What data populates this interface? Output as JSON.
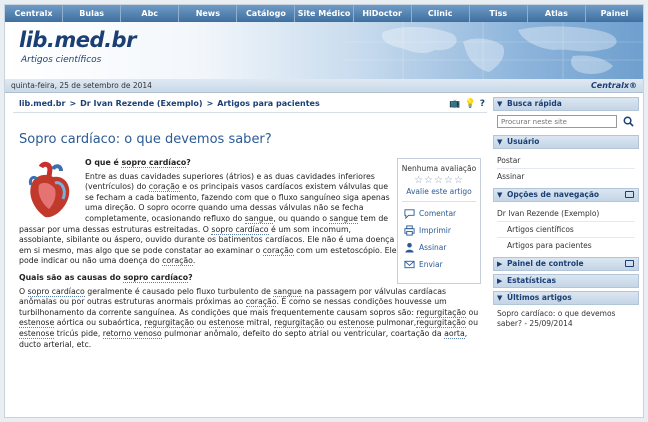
{
  "nav": [
    "Centralx",
    "Bulas",
    "Abc",
    "News",
    "Catálogo",
    "Site Médico",
    "HiDoctor",
    "Clinic",
    "Tiss",
    "Atlas",
    "Painel"
  ],
  "header": {
    "title": "lib.med.br",
    "subtitle": "Artigos científicos",
    "date": "quinta-feira, 25 de setembro de 2014",
    "brand": "Centralx®"
  },
  "breadcrumb": [
    "lib.med.br",
    "Dr Ivan Rezende (Exemplo)",
    "Artigos para pacientes"
  ],
  "breadcrumb_sep": ">",
  "tools": {
    "tv": "📺",
    "tip": "💡",
    "help": "?"
  },
  "article": {
    "title": "Sopro cardíaco: o que devemos saber?",
    "h1_prefix": "O que é ",
    "h1_link": "sopro cardíaco",
    "h1_suffix": "?",
    "p1_a": "Entre as duas cavidades superiores (átrios) e as duas cavidades inferiores (ventrículos) do ",
    "p1_link1": "coração",
    "p1_b": " e os principais vasos cardíacos existem válvulas que se fecham a cada batimento, fazendo com que o fluxo sanguíneo siga apenas uma direção. O sopro ocorre quando uma dessas válvulas não se fecha completamente, ocasionando refluxo do ",
    "p1_link2": "sangue",
    "p1_c": ", ou quando o ",
    "p1_link3": "sangue",
    "p1_d": " tem de passar por uma dessas estruturas estreitadas. O ",
    "p1_link4": "sopro cardíaco",
    "p1_e": " é um som incomum, assobiante, sibilante ou áspero, ouvido durante os batimentos cardíacos. Ele não é uma doença em si mesmo, mas algo que se pode constatar ao examinar o ",
    "p1_link5": "coração",
    "p1_f": " com um estetoscópio. Ele pode indicar ou não uma doença do ",
    "p1_link6": "coração",
    "p1_g": ".",
    "h2_prefix": "Quais são as causas do ",
    "h2_link": "sopro cardíaco",
    "h2_suffix": "?",
    "p2_a": "O ",
    "p2_link1": "sopro cardíaco",
    "p2_b": " geralmente é causado pelo fluxo turbulento de ",
    "p2_link2": "sangue",
    "p2_c": " na passagem por válvulas cardíacas anômalas ou por outras estruturas anormais próximas ao ",
    "p2_link3": "coração",
    "p2_d": ". É como se nessas condições houvesse um turbilhonamento da corrente sanguínea. As condições que mais frequentemente causam sopros são: ",
    "p2_link4": "regurgitação",
    "p2_e": " ou ",
    "p2_link5": "estenose",
    "p2_f": " aórtica ou subaórtica, ",
    "p2_link6": "regurgitação",
    "p2_g": " ou ",
    "p2_link7": "estenose",
    "p2_h": " mitral, ",
    "p2_link8": "regurgitação",
    "p2_i": " ou ",
    "p2_link9": "estenose",
    "p2_j": " pulmonar,",
    "p2_link10": "regurgitação",
    "p2_k": " ou ",
    "p2_link11": "estenose",
    "p2_l": " tricús pide, ",
    "p2_link12": "retorno venoso",
    "p2_m": " pulmonar anômalo, defeito do septo atrial ou ventricular, coartação da ",
    "p2_link13": "aorta",
    "p2_n": ", ducto arterial, etc."
  },
  "sidebox": {
    "rating_text": "Nenhuma avaliação",
    "stars": "☆☆☆☆☆",
    "rating_value": 0,
    "evaluate": "Avalie este artigo",
    "actions": [
      "Comentar",
      "Imprimir",
      "Assinar",
      "Enviar"
    ]
  },
  "sidebar": {
    "quick_search": {
      "title": "Busca rápida",
      "placeholder": "Procurar neste site"
    },
    "user": {
      "title": "Usuário",
      "items": [
        "Postar",
        "Assinar"
      ]
    },
    "nav_options": {
      "title": "Opções de navegação",
      "root": "Dr Ivan Rezende (Exemplo)",
      "items": [
        "Artigos científicos",
        "Artigos para pacientes"
      ]
    },
    "control_panel": {
      "title": "Painel de controle"
    },
    "stats": {
      "title": "Estatísticas"
    },
    "latest": {
      "title": "Últimos artigos",
      "item": "Sopro cardíaco: o que devemos saber? - 25/09/2014"
    }
  },
  "colors": {
    "accent": "#1b3f74",
    "link": "#2b5a96",
    "nav_bg": "#4d7fb0"
  }
}
